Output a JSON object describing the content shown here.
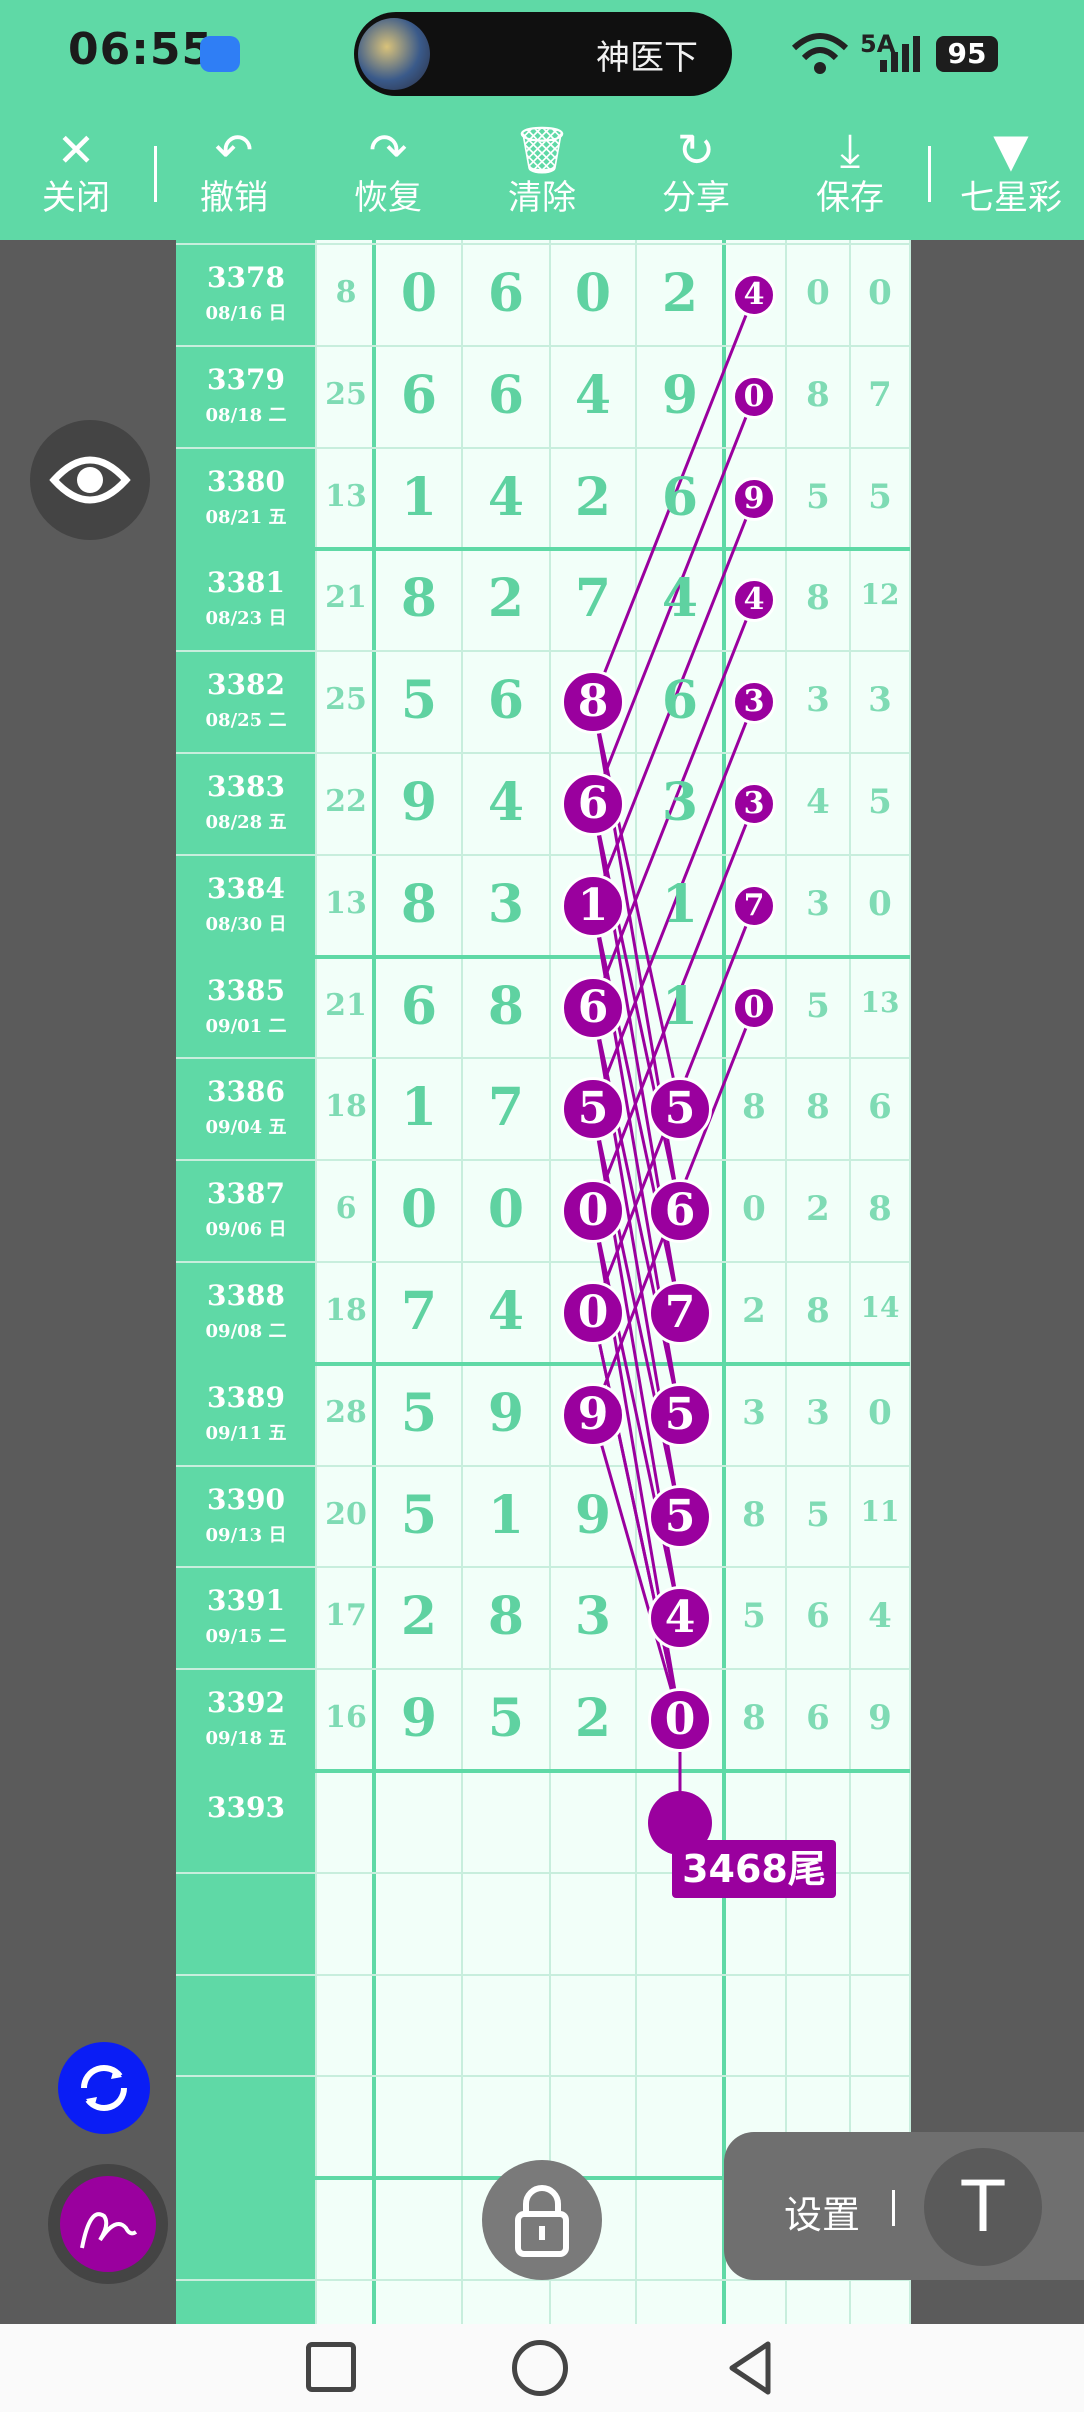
{
  "status_bar": {
    "time": "06:55",
    "pill_text": "神医下",
    "signal_text": "5A",
    "battery": "95"
  },
  "toolbar": {
    "close": "关闭",
    "undo": "撤销",
    "redo": "恢复",
    "clear": "清除",
    "share": "分享",
    "save": "保存",
    "lottery": "七星彩"
  },
  "rows": [
    {
      "issue": "3378",
      "date": "08/16 日",
      "sum": "8",
      "d": [
        "0",
        "6",
        "0",
        "2"
      ],
      "e": "4",
      "t": [
        "0",
        "0"
      ]
    },
    {
      "issue": "3379",
      "date": "08/18 二",
      "sum": "25",
      "d": [
        "6",
        "6",
        "4",
        "9"
      ],
      "e": "0",
      "t": [
        "8",
        "7"
      ]
    },
    {
      "issue": "3380",
      "date": "08/21 五",
      "sum": "13",
      "d": [
        "1",
        "4",
        "2",
        "6"
      ],
      "e": "9",
      "t": [
        "5",
        "5"
      ]
    },
    {
      "issue": "3381",
      "date": "08/23 日",
      "sum": "21",
      "d": [
        "8",
        "2",
        "7",
        "4"
      ],
      "e": "4",
      "t": [
        "8",
        "12"
      ]
    },
    {
      "issue": "3382",
      "date": "08/25 二",
      "sum": "25",
      "d": [
        "5",
        "6",
        "8",
        "6"
      ],
      "e": "3",
      "t": [
        "3",
        "3"
      ]
    },
    {
      "issue": "3383",
      "date": "08/28 五",
      "sum": "22",
      "d": [
        "9",
        "4",
        "6",
        "3"
      ],
      "e": "3",
      "t": [
        "4",
        "5"
      ]
    },
    {
      "issue": "3384",
      "date": "08/30 日",
      "sum": "13",
      "d": [
        "8",
        "3",
        "1",
        "1"
      ],
      "e": "7",
      "t": [
        "3",
        "0"
      ]
    },
    {
      "issue": "3385",
      "date": "09/01 二",
      "sum": "21",
      "d": [
        "6",
        "8",
        "6",
        "1"
      ],
      "e": "0",
      "t": [
        "5",
        "13"
      ]
    },
    {
      "issue": "3386",
      "date": "09/04 五",
      "sum": "18",
      "d": [
        "1",
        "7",
        "5",
        "5"
      ],
      "e": "8",
      "t": [
        "8",
        "6"
      ]
    },
    {
      "issue": "3387",
      "date": "09/06 日",
      "sum": "6",
      "d": [
        "0",
        "0",
        "0",
        "6"
      ],
      "e": "0",
      "t": [
        "2",
        "8"
      ]
    },
    {
      "issue": "3388",
      "date": "09/08 二",
      "sum": "18",
      "d": [
        "7",
        "4",
        "0",
        "7"
      ],
      "e": "2",
      "t": [
        "8",
        "14"
      ]
    },
    {
      "issue": "3389",
      "date": "09/11 五",
      "sum": "28",
      "d": [
        "5",
        "9",
        "9",
        "5"
      ],
      "e": "3",
      "t": [
        "3",
        "0"
      ]
    },
    {
      "issue": "3390",
      "date": "09/13 日",
      "sum": "20",
      "d": [
        "5",
        "1",
        "9",
        "5"
      ],
      "e": "8",
      "t": [
        "5",
        "11"
      ]
    },
    {
      "issue": "3391",
      "date": "09/15 二",
      "sum": "17",
      "d": [
        "2",
        "8",
        "3",
        "4"
      ],
      "e": "5",
      "t": [
        "6",
        "4"
      ]
    },
    {
      "issue": "3392",
      "date": "09/18 五",
      "sum": "16",
      "d": [
        "9",
        "5",
        "2",
        "0"
      ],
      "e": "8",
      "t": [
        "6",
        "9"
      ]
    }
  ],
  "next_issue": "3393",
  "prediction_label": "3468尾",
  "settings_label": "设置",
  "t_button": "T",
  "colors": {
    "accent": "#5fd9a6",
    "mark": "#9a009e",
    "blue": "#0a1df5"
  }
}
